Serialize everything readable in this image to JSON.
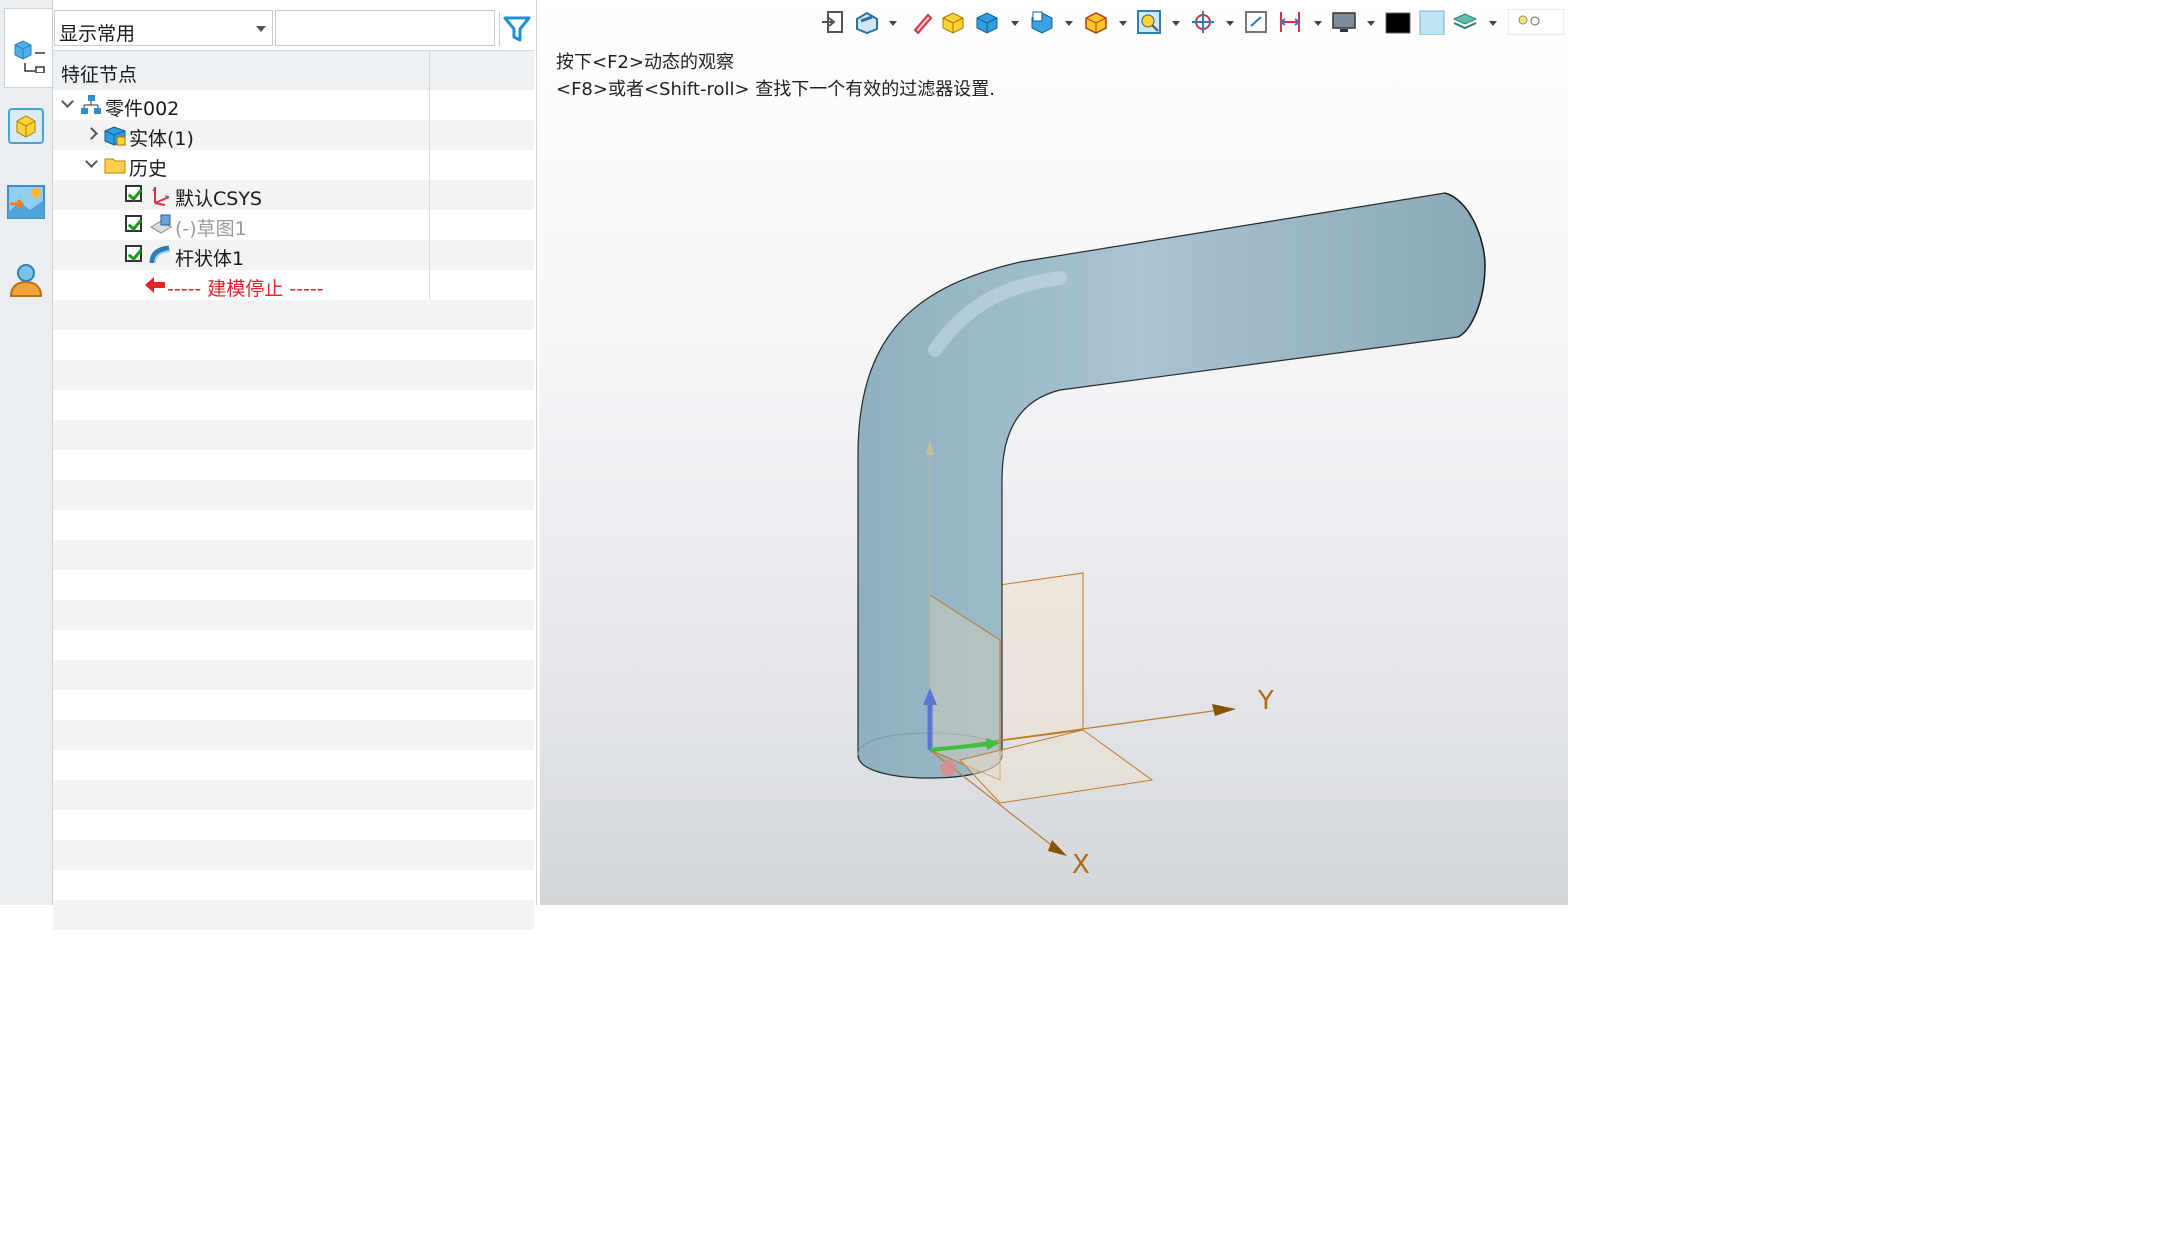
{
  "rail": {
    "items": [
      {
        "name": "feature-tree-tab",
        "icon": "part-tree-icon"
      },
      {
        "name": "part-tab",
        "icon": "box-icon"
      },
      {
        "name": "view-manager-tab",
        "icon": "image-icon"
      },
      {
        "name": "user-tab",
        "icon": "user-icon"
      }
    ]
  },
  "filter": {
    "selected": "显示常用",
    "search_value": ""
  },
  "tree": {
    "header": "特征节点",
    "rows": [
      {
        "label": "零件002",
        "icon": "assembly-icon",
        "expanded": true,
        "level": 0
      },
      {
        "label": "实体(1)",
        "icon": "solid-icon",
        "expanded": false,
        "level": 1
      },
      {
        "label": "历史",
        "icon": "folder-icon",
        "expanded": true,
        "level": 1
      },
      {
        "label": "默认CSYS",
        "icon": "csys-icon",
        "checked": true,
        "level": 2
      },
      {
        "label": "(-)草图1",
        "icon": "sketch-icon",
        "checked": true,
        "dimmed": true,
        "level": 2
      },
      {
        "label": "杆状体1",
        "icon": "rod-icon",
        "checked": true,
        "level": 2
      },
      {
        "label": "----- 建模停止 -----",
        "icon": "stop-arrow-icon",
        "stop": true,
        "level": 2
      }
    ]
  },
  "viewport": {
    "hint_line1": "按下<F2>动态的观察",
    "hint_line2": "<F8>或者<Shift-roll> 查找下一个有效的过滤器设置.",
    "axis_x": "X",
    "axis_y": "Y"
  },
  "colors": {
    "pipe": "#9fbccb",
    "axis": "#b06a14",
    "stop": "#e8222a",
    "accent": "#2b8fd6"
  }
}
